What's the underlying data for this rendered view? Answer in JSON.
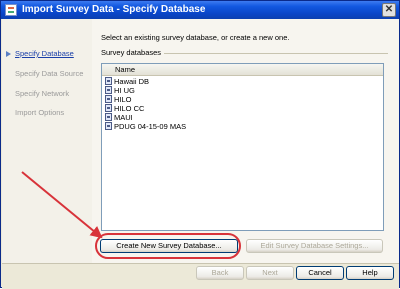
{
  "window": {
    "title": "Import Survey Data - Specify Database",
    "close_glyph": "✕"
  },
  "sidebar": {
    "items": [
      {
        "label": "Specify Database",
        "active": true
      },
      {
        "label": "Specify Data Source",
        "active": false
      },
      {
        "label": "Specify Network",
        "active": false
      },
      {
        "label": "Import Options",
        "active": false
      }
    ]
  },
  "content": {
    "prompt": "Select an existing survey database, or create a new one.",
    "group_label": "Survey databases",
    "list": {
      "header": "Name",
      "rows": [
        "Hawaii DB",
        "HI UG",
        "HILO",
        "HILO CC",
        "MAUI",
        "PDUG 04-15-09 MAS"
      ]
    },
    "create_button": "Create New Survey Database...",
    "edit_button": "Edit Survey Database Settings..."
  },
  "footer": {
    "back": "Back",
    "next": "Next",
    "cancel": "Cancel",
    "help": "Help"
  },
  "annotation": {
    "color": "#d8333a"
  }
}
